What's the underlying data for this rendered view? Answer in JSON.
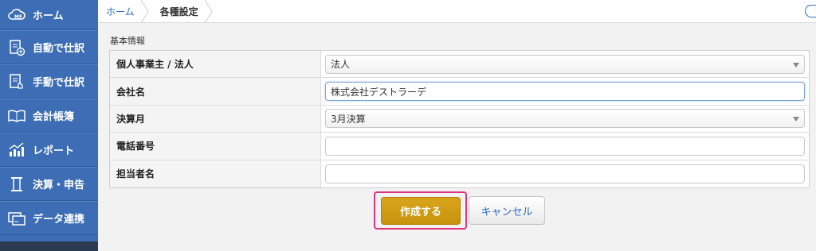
{
  "sidebar": {
    "items": [
      {
        "label": "ホーム",
        "icon": "cloud-mf-icon"
      },
      {
        "label": "自動で仕訳",
        "icon": "document-plus-icon"
      },
      {
        "label": "手動で仕訳",
        "icon": "document-hand-icon"
      },
      {
        "label": "会計帳簿",
        "icon": "book-icon"
      },
      {
        "label": "レポート",
        "icon": "chart-icon"
      },
      {
        "label": "決算・申告",
        "icon": "column-icon"
      },
      {
        "label": "データ連携",
        "icon": "card-icon"
      }
    ],
    "logo_text": "MF"
  },
  "breadcrumb": {
    "home": "ホーム",
    "current": "各種設定"
  },
  "section_title": "基本情報",
  "form": {
    "rows": [
      {
        "label": "個人事業主 / 法人",
        "value": "法人",
        "type": "select"
      },
      {
        "label": "会社名",
        "value": "株式会社デストラーデ",
        "type": "text"
      },
      {
        "label": "決算月",
        "value": "3月決算",
        "type": "select"
      },
      {
        "label": "電話番号",
        "value": "",
        "type": "text"
      },
      {
        "label": "担当者名",
        "value": "",
        "type": "text"
      }
    ]
  },
  "actions": {
    "submit_label": "作成する",
    "cancel_label": "キャンセル"
  },
  "colors": {
    "sidebar": "#3d6eb5",
    "primary_button": "#cc9810",
    "highlight_border": "#e0347a",
    "link": "#2a6ac0"
  }
}
